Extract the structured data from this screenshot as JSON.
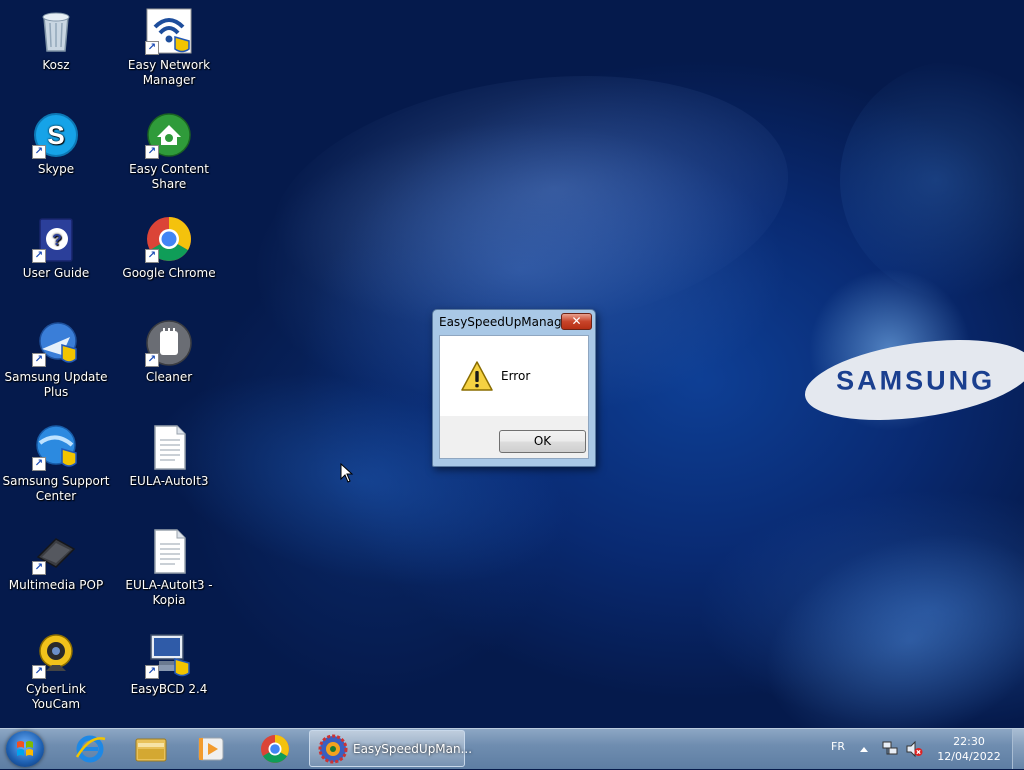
{
  "desktop": {
    "icons": [
      {
        "label": "Kosz",
        "icon": "recycle-bin-icon"
      },
      {
        "label": "Easy Network Manager",
        "icon": "network-icon"
      },
      {
        "label": "Skype",
        "icon": "skype-icon"
      },
      {
        "label": "Easy Content Share",
        "icon": "content-share-icon"
      },
      {
        "label": "User Guide",
        "icon": "user-guide-icon"
      },
      {
        "label": "Google Chrome",
        "icon": "chrome-icon"
      },
      {
        "label": "Samsung Update Plus",
        "icon": "update-icon"
      },
      {
        "label": "Cleaner",
        "icon": "cleaner-icon"
      },
      {
        "label": "Samsung Support Center",
        "icon": "support-center-icon"
      },
      {
        "label": "EULA-AutoIt3",
        "icon": "text-file-icon"
      },
      {
        "label": "Multimedia POP",
        "icon": "multimedia-icon"
      },
      {
        "label": "EULA-AutoIt3 - Kopia",
        "icon": "text-file-icon"
      },
      {
        "label": "CyberLink YouCam",
        "icon": "webcam-icon"
      },
      {
        "label": "EasyBCD 2.4",
        "icon": "easybcd-icon"
      }
    ],
    "wallpaper_logo": "SAMSUNG"
  },
  "dialog": {
    "title": "EasySpeedUpManager",
    "close_label": "✕",
    "message": "Error",
    "ok_label": "OK"
  },
  "taskbar": {
    "pinned": [
      "internet-explorer-icon",
      "file-explorer-icon",
      "media-player-icon",
      "chrome-icon"
    ],
    "active_window": "EasySpeedUpMan...",
    "language": "FR",
    "time": "22:30",
    "date": "12/04/2022"
  },
  "colors": {
    "dialog_frame": "#a9c8e6",
    "close_red": "#c8442a",
    "samsung_blue": "#1a3f8f"
  }
}
